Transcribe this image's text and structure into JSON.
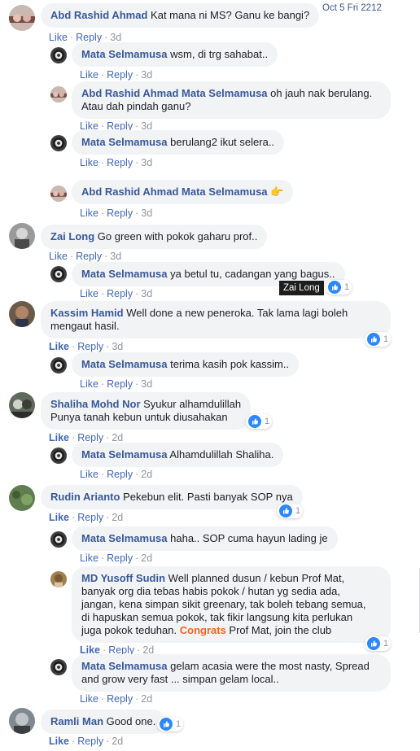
{
  "actions": {
    "like": "Like",
    "reply": "Reply"
  },
  "date_tag": "Oct 5 Fri 2212",
  "tooltip": "Zai Long",
  "colors": {
    "link": "#385898",
    "action": "#4267b2",
    "bubble": "#f2f3f5",
    "like_icon": "#2d88ff",
    "highlight": "#f26522"
  },
  "comments": [
    {
      "name": "Abd Rashid Ahmad",
      "text": "Kat mana ni MS? Ganu ke bangi?",
      "time": "3d"
    },
    {
      "name": "Mata Selmamusa",
      "text": "wsm, di trg sahabat..",
      "time": "3d"
    },
    {
      "name": "Abd Rashid Ahmad",
      "mention": "Mata Selmamusa",
      "text1": "oh jauh nak berulang.",
      "text2": "Atau dah pindah ganu?",
      "time": "3d"
    },
    {
      "name": "Mata Selmamusa",
      "text": "berulang2 ikut selera..",
      "time": "3d"
    },
    {
      "name": "Abd Rashid Ahmad",
      "mention": "Mata Selmamusa",
      "emoji": "👉",
      "time": "3d"
    },
    {
      "name": "Zai Long",
      "text": "Go green with pokok gaharu prof..",
      "time": "3d"
    },
    {
      "name": "Mata Selmamusa",
      "text": "ya betul tu, cadangan yang bagus..",
      "time": "3d",
      "reactions": "1"
    },
    {
      "name": "Kassim Hamid",
      "text1": "Well done a new peneroka. Tak lama lagi boleh",
      "text2": "mengaut hasil.",
      "time": "3d",
      "reactions": "1"
    },
    {
      "name": "Mata Selmamusa",
      "text": "terima kasih pok kassim..",
      "time": "3d"
    },
    {
      "name": "Shaliha Mohd Nor",
      "text1": "Syukur alhamdulillah",
      "text2": "Punya tanah kebun untuk diusahakan",
      "time": "2d",
      "reactions": "1"
    },
    {
      "name": "Mata Selmamusa",
      "text": "Alhamdulillah Shaliha.",
      "time": "2d"
    },
    {
      "name": "Rudin Arianto",
      "text": "Pekebun elit. Pasti banyak SOP nya",
      "time": "2d",
      "reactions": "1"
    },
    {
      "name": "Mata Selmamusa",
      "text": "haha.. SOP cuma hayun lading je",
      "time": "2d"
    },
    {
      "name": "MD Yusoff Sudin",
      "text1": "Well planned dusun / kebun Prof Mat,",
      "text2": "banyak org dia tebas habis pokok / hutan yg sedia ada,",
      "text3": "jangan, kena simpan sikit greenary, tak boleh tebang semua,",
      "text4": "di hapuskan semua pokok, tak fikir langsung kita perlukan",
      "text5": "juga pokok teduhan.",
      "highlight": "Congrats",
      "text6": "Prof Mat, join the club",
      "time": "2d",
      "reactions": "1"
    },
    {
      "name": "Mata Selmamusa",
      "text1": "gelam acasia were the most nasty, Spread",
      "text2": "and grow very fast ... simpan gelam local..",
      "time": "2d"
    },
    {
      "name": "Ramli Man",
      "text": "Good one.",
      "time": "2d",
      "reactions": "1"
    }
  ]
}
